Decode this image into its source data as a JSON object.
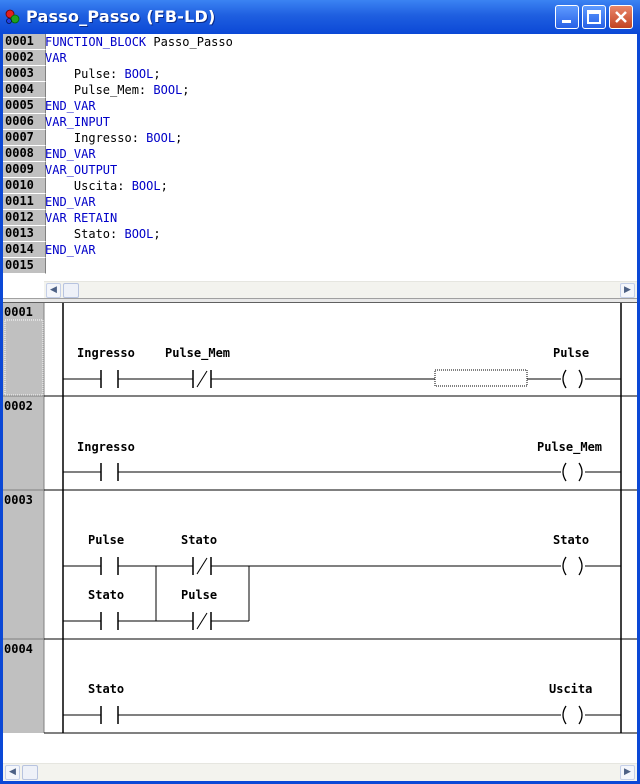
{
  "window": {
    "title": "Passo_Passo (FB-LD)",
    "controls": [
      "minimize",
      "maximize",
      "close"
    ]
  },
  "declaration": {
    "lines": [
      {
        "num": "0001",
        "kw": "FUNCTION_BLOCK",
        "text": " Passo_Passo"
      },
      {
        "num": "0002",
        "kw": "VAR",
        "text": ""
      },
      {
        "num": "0003",
        "indent": "    ",
        "text": "Pulse: ",
        "type": "BOOL",
        "end": ";"
      },
      {
        "num": "0004",
        "indent": "    ",
        "text": "Pulse_Mem: ",
        "type": "BOOL",
        "end": ";"
      },
      {
        "num": "0005",
        "kw": "END_VAR",
        "text": ""
      },
      {
        "num": "0006",
        "kw": "VAR_INPUT",
        "text": ""
      },
      {
        "num": "0007",
        "indent": "    ",
        "text": "Ingresso: ",
        "type": "BOOL",
        "end": ";"
      },
      {
        "num": "0008",
        "kw": "END_VAR",
        "text": ""
      },
      {
        "num": "0009",
        "kw": "VAR_OUTPUT",
        "text": ""
      },
      {
        "num": "0010",
        "indent": "    ",
        "text": "Uscita: ",
        "type": "BOOL",
        "end": ";"
      },
      {
        "num": "0011",
        "kw": "END_VAR",
        "text": ""
      },
      {
        "num": "0012",
        "kw": "VAR RETAIN",
        "text": ""
      },
      {
        "num": "0013",
        "indent": "    ",
        "text": "Stato: ",
        "type": "BOOL",
        "end": ";"
      },
      {
        "num": "0014",
        "kw": "END_VAR",
        "text": ""
      },
      {
        "num": "0015",
        "kw": "",
        "text": ""
      }
    ]
  },
  "networks": [
    {
      "num": "0001",
      "contacts": [
        "Ingresso",
        "Pulse_Mem"
      ],
      "coil": "Pulse"
    },
    {
      "num": "0002",
      "contacts": [
        "Ingresso"
      ],
      "coil": "Pulse_Mem"
    },
    {
      "num": "0003",
      "contacts": [
        "Pulse",
        "Stato"
      ],
      "branch": [
        "Stato",
        "Pulse"
      ],
      "coil": "Stato"
    },
    {
      "num": "0004",
      "contacts": [
        "Stato"
      ],
      "coil": "Uscita"
    }
  ],
  "colors": {
    "keyword": "#0000c8",
    "titlebar": "#0b48d6",
    "gutter": "#c0c0c0"
  }
}
